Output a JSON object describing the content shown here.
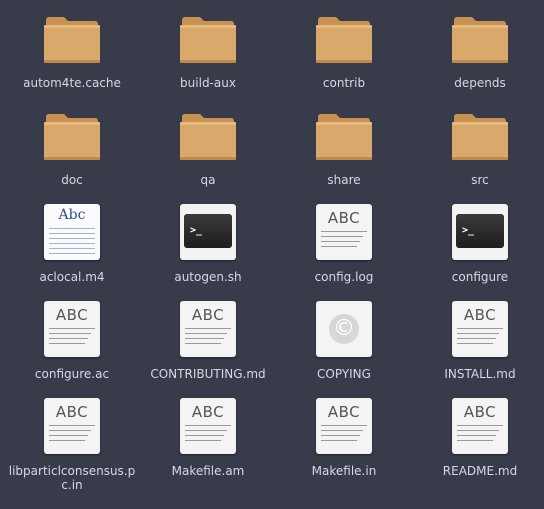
{
  "items": [
    {
      "label": "autom4te.cache",
      "type": "folder",
      "icon": "folder-icon"
    },
    {
      "label": "build-aux",
      "type": "folder",
      "icon": "folder-icon"
    },
    {
      "label": "contrib",
      "type": "folder",
      "icon": "folder-icon"
    },
    {
      "label": "depends",
      "type": "folder",
      "icon": "folder-icon"
    },
    {
      "label": "doc",
      "type": "folder",
      "icon": "folder-icon"
    },
    {
      "label": "qa",
      "type": "folder",
      "icon": "folder-icon"
    },
    {
      "label": "share",
      "type": "folder",
      "icon": "folder-icon"
    },
    {
      "label": "src",
      "type": "folder",
      "icon": "folder-icon"
    },
    {
      "label": "aclocal.m4",
      "type": "m4",
      "icon": "m4-file-icon",
      "icon_text": "Abc"
    },
    {
      "label": "autogen.sh",
      "type": "script",
      "icon": "terminal-script-icon",
      "icon_text": ">_"
    },
    {
      "label": "config.log",
      "type": "text",
      "icon": "text-file-icon",
      "icon_text": "ABC"
    },
    {
      "label": "configure",
      "type": "script",
      "icon": "terminal-script-icon",
      "icon_text": ">_"
    },
    {
      "label": "configure.ac",
      "type": "text",
      "icon": "text-file-icon",
      "icon_text": "ABC"
    },
    {
      "label": "CONTRIBUTING.md",
      "type": "text",
      "icon": "text-file-icon",
      "icon_text": "ABC"
    },
    {
      "label": "COPYING",
      "type": "copyright",
      "icon": "copyright-file-icon",
      "icon_text": "©"
    },
    {
      "label": "INSTALL.md",
      "type": "text",
      "icon": "text-file-icon",
      "icon_text": "ABC"
    },
    {
      "label": "libparticlconsensus.pc.in",
      "type": "text",
      "icon": "text-file-icon",
      "icon_text": "ABC"
    },
    {
      "label": "Makefile.am",
      "type": "text",
      "icon": "text-file-icon",
      "icon_text": "ABC"
    },
    {
      "label": "Makefile.in",
      "type": "text",
      "icon": "text-file-icon",
      "icon_text": "ABC"
    },
    {
      "label": "README.md",
      "type": "text",
      "icon": "text-file-icon",
      "icon_text": "ABC"
    }
  ],
  "colors": {
    "background": "#383c4a",
    "label_text": "#d3dae3",
    "folder_body": "#d9a86a",
    "folder_tab": "#c89252"
  }
}
